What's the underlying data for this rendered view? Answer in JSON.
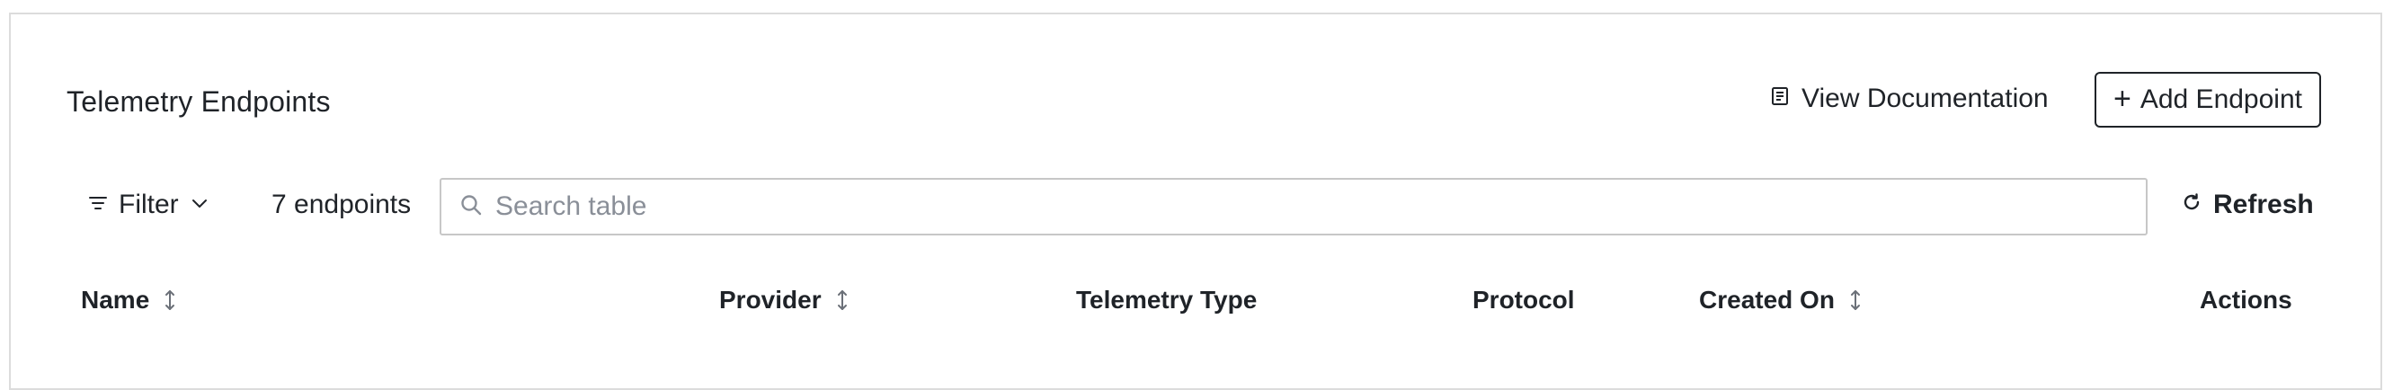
{
  "header": {
    "title": "Telemetry Endpoints",
    "view_docs_label": "View Documentation",
    "add_button_label": "Add Endpoint"
  },
  "toolbar": {
    "filter_label": "Filter",
    "count_text": "7 endpoints",
    "search_placeholder": "Search table",
    "search_value": "",
    "refresh_label": "Refresh"
  },
  "table": {
    "columns": [
      {
        "label": "Name",
        "sortable": true
      },
      {
        "label": "Provider",
        "sortable": true
      },
      {
        "label": "Telemetry Type",
        "sortable": false
      },
      {
        "label": "Protocol",
        "sortable": false
      },
      {
        "label": "Created On",
        "sortable": true
      },
      {
        "label": "Actions",
        "sortable": false
      }
    ]
  },
  "icons": {
    "docs": "document-icon",
    "add": "plus-icon",
    "filter": "filter-icon",
    "filter_dropdown": "chevron-down-icon",
    "search": "search-icon",
    "refresh": "refresh-icon",
    "sort": "sort-icon"
  },
  "colors": {
    "text": "#1f2328",
    "border": "#dcdcdc",
    "placeholder": "#8a8f98"
  }
}
